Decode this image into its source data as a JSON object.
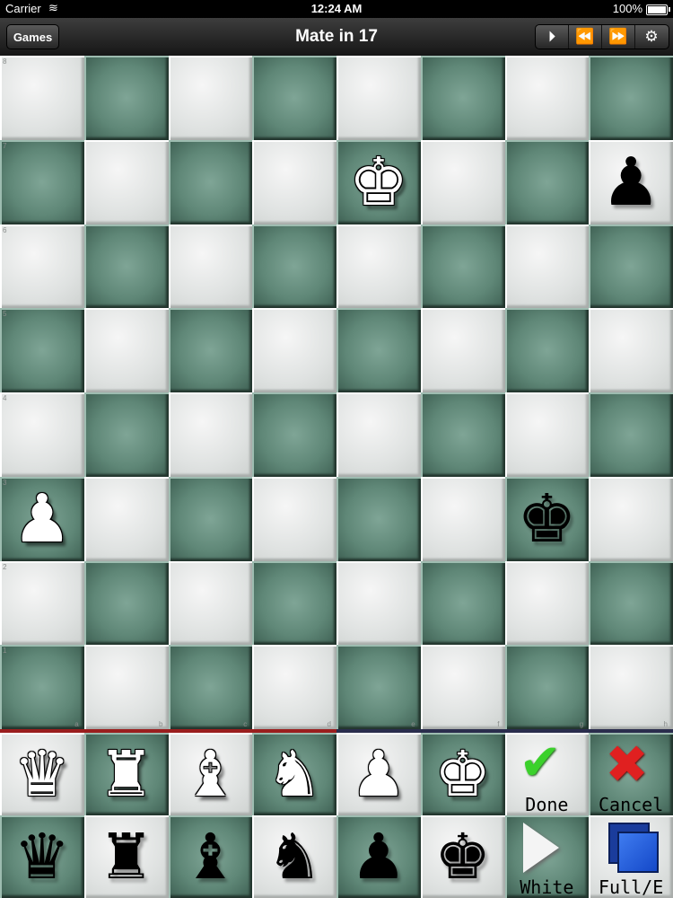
{
  "status_bar": {
    "carrier": "Carrier",
    "wifi_icon": "wifi-icon",
    "time": "12:24 AM",
    "battery_percent": "100%",
    "battery_level": 1.0
  },
  "nav": {
    "title": "Mate in 17",
    "games_label": "Games",
    "tools": [
      {
        "name": "step-play-icon",
        "glyph": "⏵"
      },
      {
        "name": "rewind-icon",
        "glyph": "⏪"
      },
      {
        "name": "fast-forward-icon",
        "glyph": "⏩"
      },
      {
        "name": "gear-icon",
        "glyph": "⚙"
      }
    ]
  },
  "board": {
    "files": [
      "a",
      "b",
      "c",
      "d",
      "e",
      "f",
      "g",
      "h"
    ],
    "ranks": [
      "8",
      "7",
      "6",
      "5",
      "4",
      "3",
      "2",
      "1"
    ],
    "pieces": [
      {
        "square": "e7",
        "piece": "king",
        "color": "white",
        "glyph": "♚"
      },
      {
        "square": "h7",
        "piece": "pawn",
        "color": "black",
        "glyph": "♟"
      },
      {
        "square": "a3",
        "piece": "pawn",
        "color": "white",
        "glyph": "♟"
      },
      {
        "square": "g3",
        "piece": "king",
        "color": "black",
        "glyph": "♚"
      }
    ]
  },
  "palette": {
    "white_row": [
      {
        "name": "white-queen-icon",
        "glyph": "♛",
        "color": "white"
      },
      {
        "name": "white-rook-icon",
        "glyph": "♜",
        "color": "white"
      },
      {
        "name": "white-bishop-icon",
        "glyph": "♝",
        "color": "white"
      },
      {
        "name": "white-knight-icon",
        "glyph": "♞",
        "color": "white"
      },
      {
        "name": "white-pawn-icon",
        "glyph": "♟",
        "color": "white"
      },
      {
        "name": "white-king-icon",
        "glyph": "♚",
        "color": "white"
      }
    ],
    "black_row": [
      {
        "name": "black-queen-icon",
        "glyph": "♛",
        "color": "black"
      },
      {
        "name": "black-rook-icon",
        "glyph": "♜",
        "color": "black"
      },
      {
        "name": "black-bishop-icon",
        "glyph": "♝",
        "color": "black"
      },
      {
        "name": "black-knight-icon",
        "glyph": "♞",
        "color": "black"
      },
      {
        "name": "black-pawn-icon",
        "glyph": "♟",
        "color": "black"
      },
      {
        "name": "black-king-icon",
        "glyph": "♚",
        "color": "black"
      }
    ],
    "done_label": "Done",
    "cancel_label": "Cancel",
    "side_label": "White",
    "full_label": "Full/E"
  },
  "colors": {
    "light_square": "#dfe2e1",
    "dark_square": "#5f8777",
    "divider_white_side": "#9a1e1e",
    "divider_black_side": "#2a2d4d",
    "done_check": "#3bd12b",
    "cancel_cross": "#e02020"
  }
}
